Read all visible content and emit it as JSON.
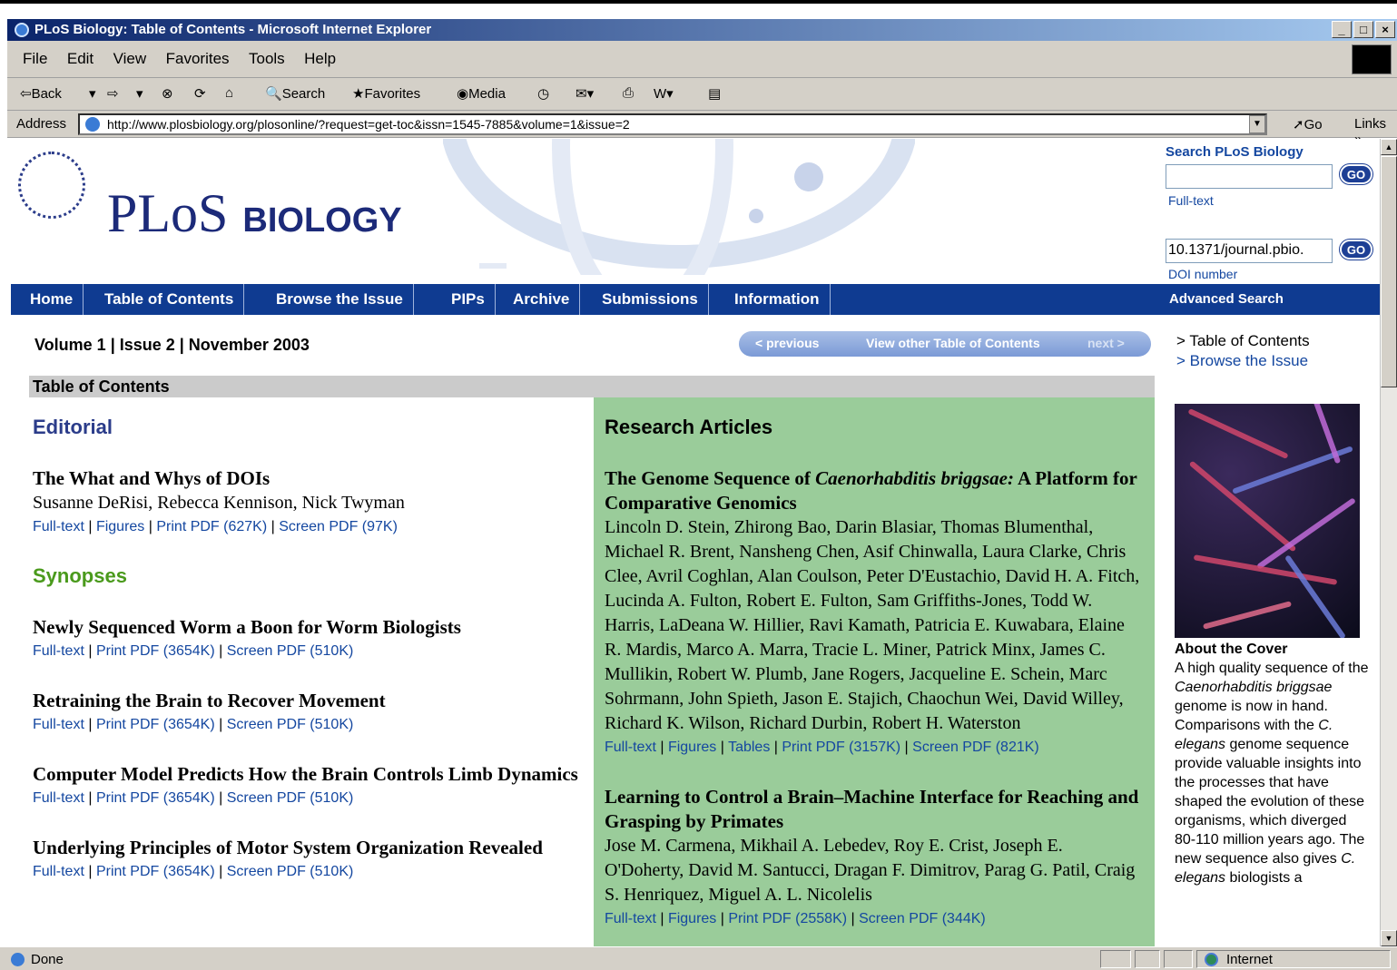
{
  "window": {
    "title": "PLoS Biology: Table of Contents - Microsoft Internet Explorer",
    "buttons": [
      "_",
      "□",
      "×"
    ]
  },
  "menu": [
    "File",
    "Edit",
    "View",
    "Favorites",
    "Tools",
    "Help"
  ],
  "toolbar": {
    "back": "⇦Back",
    "search": "Search",
    "favorites": "Favorites",
    "media": "Media"
  },
  "address": {
    "label": "Address",
    "url": "http://www.plosbiology.org/plosonline/?request=get-toc&issn=1545-7885&volume=1&issue=2",
    "go": "Go",
    "links": "Links »"
  },
  "site": {
    "logo_main": "PLoS",
    "logo_sub": "BIOLOGY",
    "search_title": "Search PLoS Biology",
    "go": "GO",
    "fulltext_label": "Full-text",
    "doi_value": "10.1371/journal.pbio.",
    "doi_label": "DOI number",
    "nav": [
      "Home",
      "Table of Contents",
      "Browse the Issue",
      "PIPs",
      "Archive",
      "Submissions",
      "Information"
    ],
    "advanced_search": "Advanced Search",
    "volume_line": "Volume 1 | Issue 2 | November 2003",
    "pager": {
      "previous": "< previous",
      "view_other": "View other Table of Contents",
      "next": "next >"
    },
    "right_links": [
      "> Table of Contents",
      "> Browse the Issue"
    ],
    "toc_heading": "Table of Contents",
    "editorial_head": "Editorial",
    "synopses_head": "Synopses",
    "research_head": "Research Articles"
  },
  "editorial": [
    {
      "title": "The What and Whys of DOIs",
      "authors": "Susanne DeRisi, Rebecca Kennison, Nick Twyman",
      "links": [
        "Full-text",
        "Figures",
        "Print PDF (627K)",
        "Screen PDF (97K)"
      ]
    }
  ],
  "synopses": [
    {
      "title": "Newly Sequenced Worm a Boon for Worm Biologists",
      "links": [
        "Full-text",
        "Print PDF (3654K)",
        "Screen PDF (510K)"
      ]
    },
    {
      "title": "Retraining the Brain to Recover Movement",
      "links": [
        "Full-text",
        "Print PDF (3654K)",
        "Screen PDF (510K)"
      ]
    },
    {
      "title": "Computer Model Predicts How the Brain Controls Limb Dynamics",
      "links": [
        "Full-text",
        "Print PDF (3654K)",
        "Screen PDF (510K)"
      ]
    },
    {
      "title": "Underlying Principles of Motor System Organization Revealed",
      "links": [
        "Full-text",
        "Print PDF (3654K)",
        "Screen PDF (510K)"
      ]
    }
  ],
  "research": [
    {
      "title_pre": "The Genome Sequence of ",
      "title_em": "Caenorhabditis briggsae:",
      "title_post": " A Platform for Comparative Genomics",
      "authors": "Lincoln D. Stein, Zhirong Bao, Darin Blasiar, Thomas Blumenthal, Michael R. Brent, Nansheng Chen, Asif Chinwalla, Laura Clarke, Chris Clee, Avril Coghlan, Alan Coulson, Peter D'Eustachio, David H. A. Fitch, Lucinda A. Fulton, Robert E. Fulton, Sam Griffiths-Jones, Todd W. Harris, LaDeana W. Hillier, Ravi Kamath, Patricia E. Kuwabara, Elaine R. Mardis, Marco A. Marra, Tracie L. Miner, Patrick Minx, James C. Mullikin, Robert W. Plumb, Jane Rogers, Jacqueline E. Schein, Marc Sohrmann, John Spieth, Jason E. Stajich, Chaochun Wei, David Willey, Richard K. Wilson, Richard Durbin, Robert H. Waterston",
      "links": [
        "Full-text",
        "Figures",
        "Tables",
        "Print PDF (3157K)",
        "Screen PDF (821K)"
      ]
    },
    {
      "title_pre": "Learning to Control a Brain–Machine Interface for Reaching and Grasping by Primates",
      "title_em": "",
      "title_post": "",
      "authors": "Jose M. Carmena, Mikhail A. Lebedev, Roy E. Crist, Joseph E. O'Doherty, David M. Santucci, Dragan F. Dimitrov, Parag G. Patil, Craig S. Henriquez, Miguel A. L. Nicolelis",
      "links": [
        "Full-text",
        "Figures",
        "Print PDF (2558K)",
        "Screen PDF (344K)"
      ]
    }
  ],
  "cover": {
    "heading": "About the Cover",
    "text_1": "A high quality sequence of the ",
    "text_em1": "Caenorhabditis briggsae",
    "text_2": " genome is now in hand. Comparisons with the ",
    "text_em2": "C. elegans",
    "text_3": " genome sequence provide valuable insights into the processes that have shaped the evolution of these organisms, which diverged 80-110 million years ago. The new sequence also gives ",
    "text_em3": "C. elegans",
    "text_4": " biologists a"
  },
  "status": {
    "text": "Done",
    "zone": "Internet"
  },
  "colors": {
    "nav_bg": "#0f3b91",
    "research_bg": "#9acc9a",
    "editorial_head": "#2b3c8a",
    "synopses_head": "#4a9a1c",
    "link": "#1447a0"
  }
}
